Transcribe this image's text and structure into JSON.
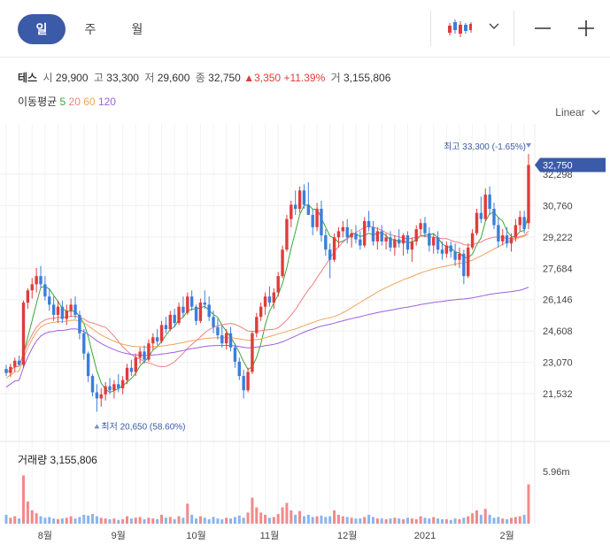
{
  "tabs": [
    {
      "label": "일",
      "active": true
    },
    {
      "label": "주",
      "active": false
    },
    {
      "label": "월",
      "active": false
    }
  ],
  "info": {
    "name": "테스",
    "open_label": "시",
    "open": "29,900",
    "high_label": "고",
    "high": "33,300",
    "low_label": "저",
    "low": "29,600",
    "close_label": "종",
    "close": "32,750",
    "change": "▲3,350",
    "change_pct": "+11.39%",
    "volume_label": "거",
    "volume": "3,155,806"
  },
  "ma": {
    "label": "이동평균",
    "periods": [
      "5",
      "20",
      "60",
      "120"
    ],
    "colors": [
      "#3aa63a",
      "#f08080",
      "#f0a45a",
      "#a060e0"
    ]
  },
  "scale_label": "Linear",
  "max_annotation": "최고 33,300 (-1.65%)",
  "min_annotation": "최저 20,650 (58.60%)",
  "current_price_label": "32,750",
  "volume_panel": {
    "label": "거래량 3,155,806",
    "max_label": "5.96m"
  },
  "colors": {
    "up": "#e03c3c",
    "down": "#3a7fdc",
    "accent": "#3b5aa8"
  },
  "chart_data": {
    "type": "candlestick",
    "y_ticks": [
      "32,298",
      "30,760",
      "29,222",
      "27,684",
      "26,146",
      "24,608",
      "23,070",
      "21,532"
    ],
    "y_tick_values": [
      32298,
      30760,
      29222,
      27684,
      26146,
      24608,
      23070,
      21532
    ],
    "ylim": [
      20450,
      33900
    ],
    "x_ticks": [
      {
        "label": "8월",
        "index": 9
      },
      {
        "label": "9월",
        "index": 26
      },
      {
        "label": "10월",
        "index": 44
      },
      {
        "label": "11월",
        "index": 61
      },
      {
        "label": "12월",
        "index": 79
      },
      {
        "label": "2021",
        "index": 97
      },
      {
        "label": "2월",
        "index": 116
      }
    ],
    "volume_max": 5960000,
    "candles": [
      [
        22750,
        22950,
        22400,
        22550
      ],
      [
        22550,
        23000,
        22350,
        22850
      ],
      [
        22850,
        23300,
        22600,
        23150
      ],
      [
        23150,
        23400,
        22900,
        22950
      ],
      [
        22950,
        26100,
        22800,
        26000
      ],
      [
        26000,
        26700,
        25700,
        26600
      ],
      [
        26600,
        27200,
        26200,
        26900
      ],
      [
        26900,
        27700,
        26500,
        27300
      ],
      [
        27300,
        27800,
        26700,
        26900
      ],
      [
        26900,
        27300,
        26100,
        26300
      ],
      [
        26300,
        26700,
        25600,
        25900
      ],
      [
        25900,
        26300,
        25100,
        25400
      ],
      [
        25400,
        26100,
        25000,
        25800
      ],
      [
        25800,
        26100,
        25000,
        25200
      ],
      [
        25200,
        25900,
        24900,
        25600
      ],
      [
        25600,
        26200,
        25300,
        25900
      ],
      [
        25900,
        26300,
        25200,
        25400
      ],
      [
        25400,
        25600,
        24200,
        24500
      ],
      [
        24500,
        24700,
        23200,
        23500
      ],
      [
        23500,
        23600,
        22100,
        22400
      ],
      [
        22400,
        22500,
        21400,
        21600
      ],
      [
        21600,
        22000,
        20650,
        21300
      ],
      [
        21300,
        21800,
        20900,
        21500
      ],
      [
        21500,
        22100,
        21200,
        21900
      ],
      [
        21900,
        22300,
        21500,
        21700
      ],
      [
        21700,
        22200,
        21300,
        22000
      ],
      [
        22000,
        22500,
        21600,
        21800
      ],
      [
        21800,
        22400,
        21500,
        22200
      ],
      [
        22200,
        23000,
        22000,
        22800
      ],
      [
        22800,
        23200,
        22400,
        22600
      ],
      [
        22600,
        23500,
        22400,
        23300
      ],
      [
        23300,
        23800,
        23000,
        23600
      ],
      [
        23600,
        23900,
        23000,
        23200
      ],
      [
        23200,
        24200,
        23100,
        24000
      ],
      [
        24000,
        24500,
        23700,
        24300
      ],
      [
        24300,
        24700,
        23900,
        24100
      ],
      [
        24100,
        25100,
        24000,
        24900
      ],
      [
        24900,
        25300,
        24500,
        24700
      ],
      [
        24700,
        25600,
        24600,
        25400
      ],
      [
        25400,
        25700,
        24800,
        25000
      ],
      [
        25000,
        26000,
        24900,
        25800
      ],
      [
        25800,
        26300,
        25300,
        25500
      ],
      [
        25500,
        26500,
        25400,
        26300
      ],
      [
        26300,
        26600,
        25600,
        25800
      ],
      [
        25800,
        25900,
        24900,
        25100
      ],
      [
        25100,
        26200,
        25000,
        26000
      ],
      [
        26000,
        26600,
        25700,
        25900
      ],
      [
        25900,
        26300,
        25100,
        25300
      ],
      [
        25300,
        25600,
        24500,
        24800
      ],
      [
        24800,
        25200,
        24200,
        24400
      ],
      [
        24400,
        24900,
        23800,
        24000
      ],
      [
        24000,
        24700,
        23700,
        24500
      ],
      [
        24500,
        24800,
        23600,
        23800
      ],
      [
        23800,
        24000,
        22800,
        23100
      ],
      [
        23100,
        23300,
        22200,
        22400
      ],
      [
        22400,
        22700,
        21300,
        21700
      ],
      [
        21700,
        22800,
        21600,
        22600
      ],
      [
        22600,
        24600,
        22500,
        24500
      ],
      [
        24500,
        25500,
        24300,
        25300
      ],
      [
        25300,
        26000,
        25100,
        25800
      ],
      [
        25800,
        26500,
        25400,
        26300
      ],
      [
        26300,
        26800,
        25800,
        26000
      ],
      [
        26000,
        26700,
        25700,
        26500
      ],
      [
        26500,
        27500,
        26300,
        27300
      ],
      [
        27300,
        28800,
        27200,
        28600
      ],
      [
        28600,
        30300,
        28500,
        30100
      ],
      [
        30100,
        31000,
        29700,
        30800
      ],
      [
        30800,
        31500,
        30300,
        30600
      ],
      [
        30600,
        31700,
        30400,
        31500
      ],
      [
        31500,
        31800,
        30600,
        30800
      ],
      [
        30800,
        31900,
        30500,
        30300
      ],
      [
        30300,
        30600,
        29300,
        29700
      ],
      [
        29700,
        30900,
        29500,
        30600
      ],
      [
        30600,
        31000,
        29000,
        29300
      ],
      [
        29300,
        29600,
        28300,
        28600
      ],
      [
        28600,
        28900,
        27200,
        28100
      ],
      [
        28100,
        29400,
        28000,
        29200
      ],
      [
        29200,
        29700,
        28700,
        29500
      ],
      [
        29500,
        30000,
        29200,
        29700
      ],
      [
        29700,
        30100,
        28900,
        29200
      ],
      [
        29200,
        29600,
        28700,
        29400
      ],
      [
        29400,
        29800,
        28900,
        29100
      ],
      [
        29100,
        29500,
        28600,
        28800
      ],
      [
        28800,
        30200,
        28700,
        30000
      ],
      [
        30000,
        30500,
        29500,
        29700
      ],
      [
        29700,
        30000,
        28800,
        29000
      ],
      [
        29000,
        29700,
        28600,
        29500
      ],
      [
        29500,
        29800,
        28800,
        29000
      ],
      [
        29000,
        29400,
        28600,
        29200
      ],
      [
        29200,
        29500,
        28500,
        28700
      ],
      [
        28700,
        29300,
        28300,
        29100
      ],
      [
        29100,
        29600,
        28700,
        28900
      ],
      [
        28900,
        29400,
        28300,
        29300
      ],
      [
        29300,
        29500,
        28400,
        28600
      ],
      [
        28600,
        29200,
        28000,
        29000
      ],
      [
        29000,
        29800,
        28800,
        29600
      ],
      [
        29600,
        30100,
        29300,
        29900
      ],
      [
        29900,
        30200,
        29200,
        29400
      ],
      [
        29400,
        29700,
        28500,
        28800
      ],
      [
        28800,
        29400,
        28400,
        29200
      ],
      [
        29200,
        29500,
        28400,
        28600
      ],
      [
        28600,
        29000,
        28100,
        28400
      ],
      [
        28400,
        29000,
        28200,
        28800
      ],
      [
        28800,
        29000,
        28200,
        28500
      ],
      [
        28500,
        28900,
        27800,
        28100
      ],
      [
        28100,
        28700,
        27700,
        28400
      ],
      [
        28400,
        28600,
        26900,
        27300
      ],
      [
        27300,
        28900,
        27200,
        28700
      ],
      [
        28700,
        29600,
        28600,
        29400
      ],
      [
        29400,
        30600,
        29300,
        30400
      ],
      [
        30400,
        31200,
        29900,
        30100
      ],
      [
        30100,
        31600,
        30000,
        31300
      ],
      [
        31300,
        31700,
        30300,
        30600
      ],
      [
        30600,
        30900,
        29600,
        29800
      ],
      [
        29800,
        30200,
        28700,
        29000
      ],
      [
        29000,
        29600,
        28800,
        29300
      ],
      [
        29300,
        29700,
        28700,
        28900
      ],
      [
        28900,
        29400,
        28500,
        29200
      ],
      [
        29200,
        30100,
        29000,
        29800
      ],
      [
        29800,
        30500,
        29500,
        30200
      ],
      [
        30200,
        30500,
        29400,
        29600
      ],
      [
        29900,
        33300,
        29600,
        32750
      ]
    ]
  }
}
